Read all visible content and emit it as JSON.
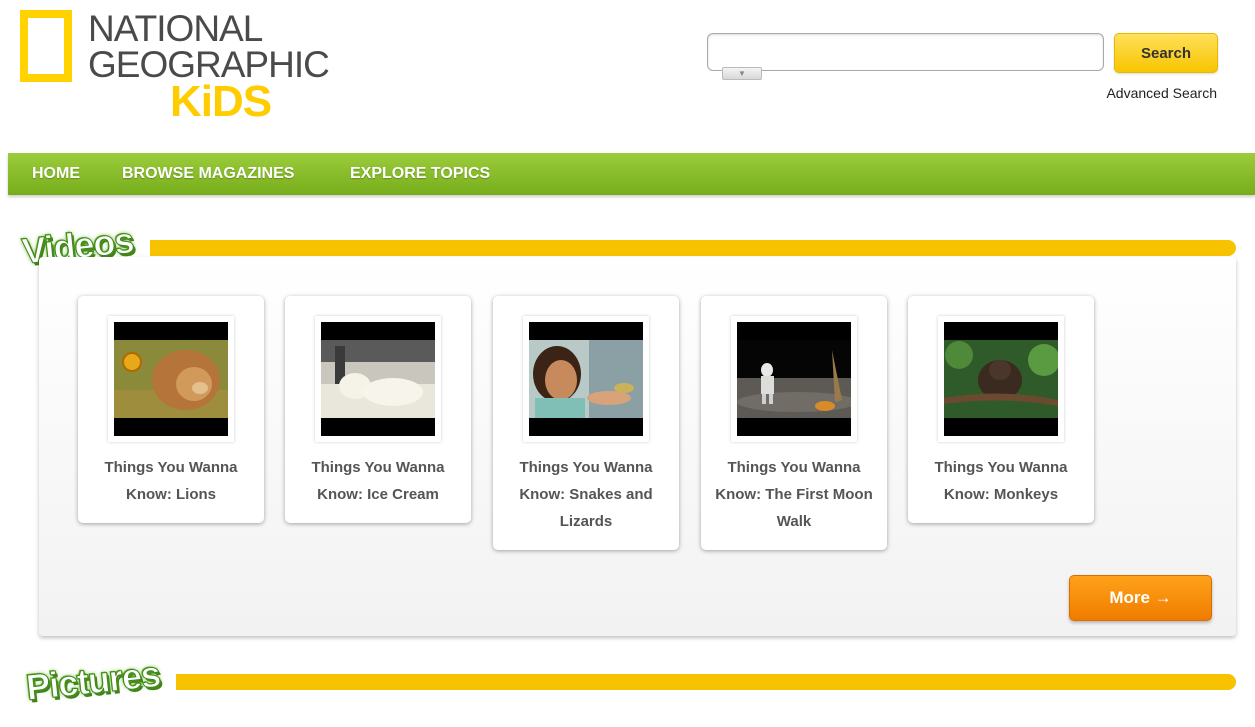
{
  "logo": {
    "line1": "NATIONAL",
    "line2": "GEOGRAPHIC",
    "line3": "KiDS"
  },
  "search": {
    "value": "",
    "button_label": "Search",
    "advanced_label": "Advanced Search",
    "dropdown_glyph": "▼"
  },
  "nav": {
    "items": [
      {
        "label": "HOME"
      },
      {
        "label": "BROWSE MAGAZINES"
      },
      {
        "label": "EXPLORE TOPICS"
      }
    ]
  },
  "videos": {
    "title": "Videos",
    "cards": [
      {
        "title": "Things You Wanna Know: Lions"
      },
      {
        "title": "Things You Wanna Know: Ice Cream"
      },
      {
        "title": "Things You Wanna Know: Snakes and Lizards"
      },
      {
        "title": "Things You Wanna Know: The First Moon Walk"
      },
      {
        "title": "Things You Wanna Know: Monkeys"
      }
    ],
    "more_label": "More →"
  },
  "pictures": {
    "title": "Pictures"
  },
  "colors": {
    "brand_yellow": "#ffd200",
    "nav_green": "#86bc25",
    "title_green": "#3f8a1a",
    "more_orange": "#f58a00"
  }
}
